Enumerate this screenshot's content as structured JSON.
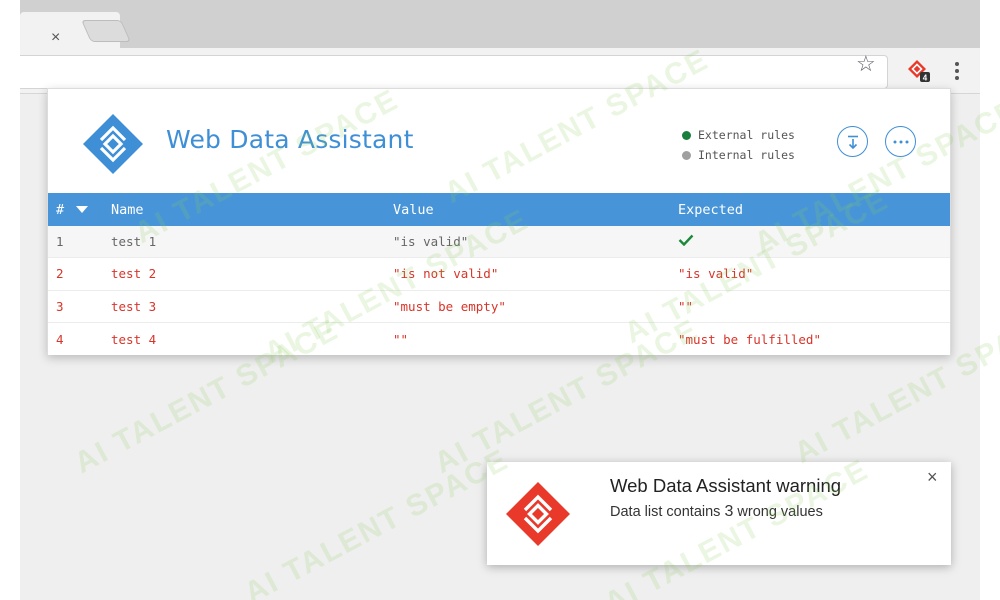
{
  "browser": {
    "tab_close_glyph": "×",
    "bookmark_glyph": "☆",
    "extension_badge": "4"
  },
  "popup": {
    "title": "Web Data Assistant",
    "legend": [
      {
        "label": "External rules",
        "color": "#1a7f3c"
      },
      {
        "label": "Internal rules",
        "color": "#a0a0a0"
      }
    ],
    "table": {
      "headers": {
        "num": "#",
        "name": "Name",
        "value": "Value",
        "expected": "Expected"
      },
      "rows": [
        {
          "num": "1",
          "name": "test 1",
          "value": "\"is valid\"",
          "expected": "",
          "status": "valid"
        },
        {
          "num": "2",
          "name": "test 2",
          "value": "\"is not valid\"",
          "expected": "\"is valid\"",
          "status": "invalid"
        },
        {
          "num": "3",
          "name": "test 3",
          "value": "\"must be empty\"",
          "expected": "\"\"",
          "status": "invalid"
        },
        {
          "num": "4",
          "name": "test 4",
          "value": "\"\"",
          "expected": "\"must be fulfilled\"",
          "status": "invalid"
        }
      ]
    }
  },
  "notification": {
    "title": "Web Data Assistant warning",
    "message_prefix": "Data list contains ",
    "message_count": "3",
    "message_suffix": " wrong values",
    "close_glyph": "×"
  },
  "watermark": {
    "text": "AI TALENT SPACE"
  },
  "colors": {
    "accent_blue": "#3f8fd6",
    "header_blue": "#4795d8",
    "error_red": "#d8352a",
    "logo_red": "#e8392b",
    "valid_green": "#1a8a3a"
  }
}
